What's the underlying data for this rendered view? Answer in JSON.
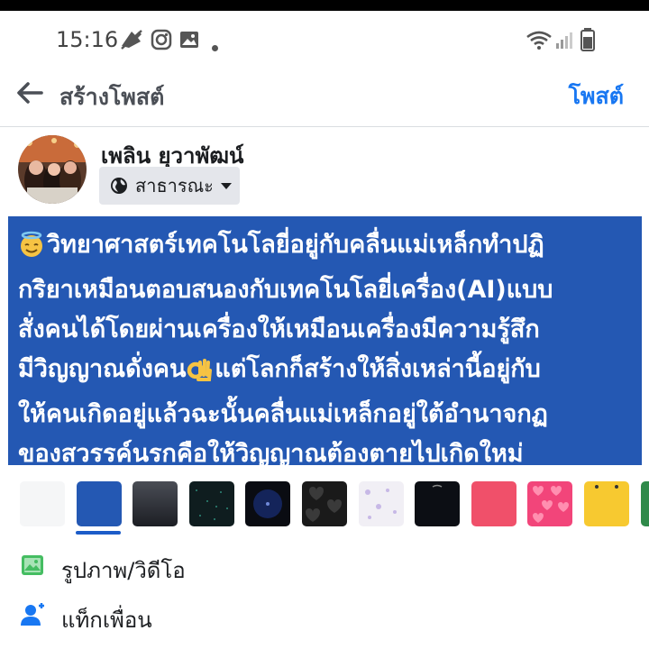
{
  "status_bar": {
    "time": "15:16",
    "icons": [
      "do-not-disturb-icon",
      "instagram-icon",
      "gallery-icon",
      "notification-dot",
      "wifi-icon",
      "signal-icon",
      "battery-icon"
    ]
  },
  "header": {
    "title": "สร้างโพสต์",
    "post_label": "โพสต์",
    "accent": "#1877f2"
  },
  "author": {
    "name": "เพลิน ยุวาพัฒน์",
    "privacy": "สาธารณะ"
  },
  "post": {
    "background": "#2458b3",
    "lines": [
      "วิทยาศาสตร์เทคโนโลยี่อยู่กับคลื่นแม่เหล็กทำปฏิ",
      "กริยาเหมือนตอบสนองกับเทคโนโลยี่เครื่อง(AI)แบบ",
      "สั่งคนได้โดยผ่านเครื่องให้เหมือนเครื่องมีความรู้สึก",
      "มีวิญญาณดั่งคน",
      "แต่โลกก็สร้างให้สิ่งเหล่านี้อยู่กับ",
      "ให้คนเกิดอยู่แล้วฉะนั้นคลื่นแม่เหล็กอยู่ใต้อำนาจกฏ",
      "ของสวรรค์นรกคือให้วิญญาณต้องตายไปเกิดใหม่"
    ]
  },
  "backgrounds": {
    "selected_index": 1,
    "swatches": [
      "white",
      "blue",
      "dark-gradient",
      "dark-sparkle",
      "dark-circle",
      "dark-hearts",
      "light-pattern",
      "black",
      "coral",
      "pink-hearts",
      "yellow",
      "green"
    ]
  },
  "options": [
    {
      "label": "รูปภาพ/วิดีโอ",
      "icon": "photo-video-icon"
    },
    {
      "label": "แท็กเพื่อน",
      "icon": "tag-friend-icon"
    }
  ]
}
